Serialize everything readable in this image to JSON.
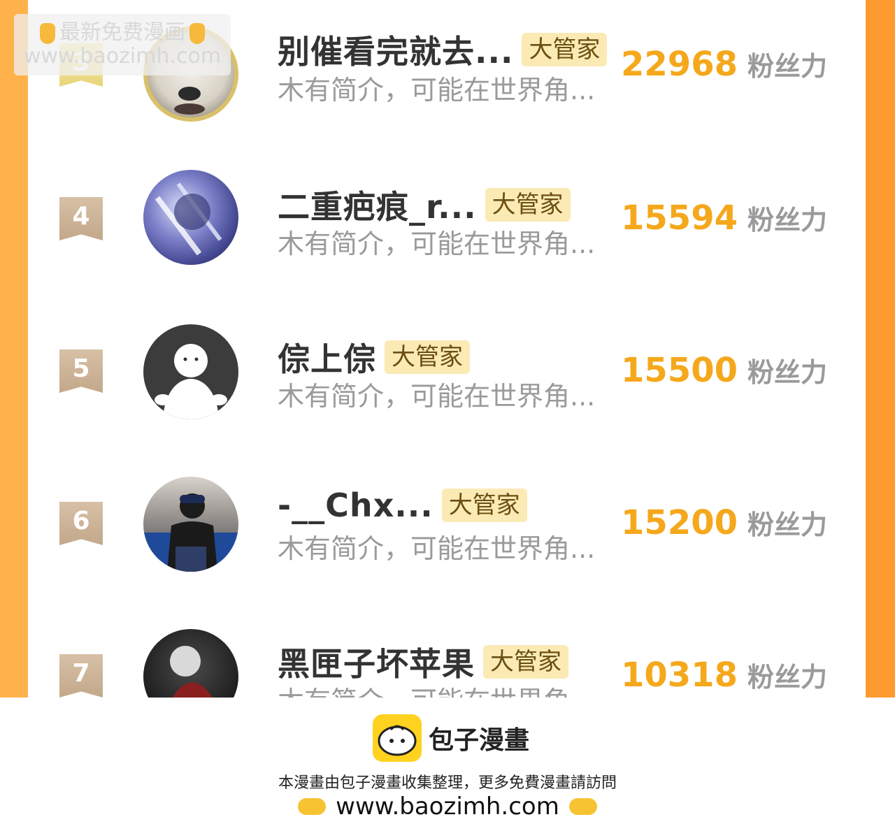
{
  "watermark": {
    "line1": "最新免费漫画",
    "line2": "www.baozimh.com"
  },
  "rows": [
    {
      "rank": "3",
      "name": "别催看完就去...",
      "tag": "大管家",
      "bio": "木有简介，可能在世界角...",
      "fans": "22968",
      "fans_label": "粉丝力"
    },
    {
      "rank": "4",
      "name": "二重疤痕_r...",
      "tag": "大管家",
      "bio": "木有简介，可能在世界角...",
      "fans": "15594",
      "fans_label": "粉丝力"
    },
    {
      "rank": "5",
      "name": "倧上倧",
      "tag": "大管家",
      "bio": "木有简介，可能在世界角...",
      "fans": "15500",
      "fans_label": "粉丝力"
    },
    {
      "rank": "6",
      "name": "-__Chx...",
      "tag": "大管家",
      "bio": "木有简介，可能在世界角...",
      "fans": "15200",
      "fans_label": "粉丝力"
    },
    {
      "rank": "7",
      "name": "黑匣子坏苹果",
      "tag": "大管家",
      "bio": "木有简介，可能在世界角...",
      "fans": "10318",
      "fans_label": "粉丝力"
    }
  ],
  "footer": {
    "brand": "包子漫畫",
    "note": "本漫畫由包子漫畫收集整理，更多免費漫畫請訪問",
    "url": "www.baozimh.com"
  },
  "colors": {
    "accent_orange": "#f5a81b",
    "frame_orange": "#ffa43a",
    "tag_bg": "#fbeab4"
  }
}
